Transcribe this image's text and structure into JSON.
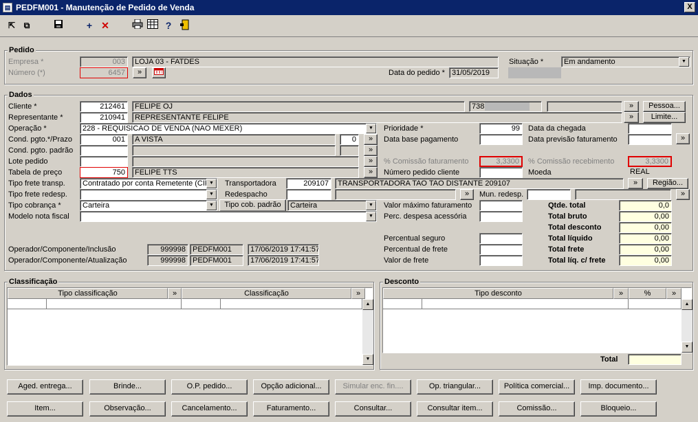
{
  "window": {
    "title": "PEDFM001 - Manutenção de Pedido de Venda",
    "close": "X"
  },
  "toolbar": {
    "icons": [
      "navigate-icon",
      "copy-icon",
      "save-icon",
      "add-icon",
      "delete-icon",
      "print-icon",
      "grid-icon",
      "help-icon",
      "exit-icon"
    ],
    "add": "+",
    "delete": "✕",
    "help": "?"
  },
  "pedido": {
    "title": "Pedido",
    "empresa_label": "Empresa *",
    "empresa_code": "003",
    "empresa_name": "LOJA 03 - FATDES",
    "numero_label": "Número (*)",
    "numero_value": "6457",
    "data_label": "Data do pedido *",
    "data_value": "31/05/2019",
    "situacao_label": "Situação *",
    "situacao_value": "Em andamento"
  },
  "dados": {
    "title": "Dados",
    "cliente_label": "Cliente *",
    "cliente_code": "212461",
    "cliente_name": "FELIPE OJ",
    "cliente_extra": "738",
    "representante_label": "Representante *",
    "representante_code": "210941",
    "representante_name": "REPRESENTANTE FELIPE",
    "operacao_label": "Operação *",
    "operacao_value": "228 - REQUISICAO DE VENDA (NAO MEXER)",
    "cond_label": "Cond. pgto.*/Prazo",
    "cond_code": "001",
    "cond_name": "A VISTA",
    "cond_prazo": "0",
    "cond_padrao_label": "Cond. pgto. padrão",
    "lote_label": "Lote pedido",
    "tabela_label": "Tabela de preço",
    "tabela_code": "750",
    "tabela_name": "FELIPE TTS",
    "frete_transp_label": "Tipo frete transp.",
    "frete_transp_value": "Contratado por conta Remetente (CIF)",
    "frete_redesp_label": "Tipo frete redesp.",
    "cobranca_label": "Tipo cobrança *",
    "cobranca_value": "Carteira",
    "modelo_label": "Modelo nota fiscal",
    "transportadora_label": "Transportadora",
    "transportadora_code": "209107",
    "transportadora_name": "TRANSPORTADORA TAO TAO DISTANTE  209107",
    "redespacho_label": "Redespacho",
    "mun_redesp_label": "Mun. redesp.",
    "tipo_cob_padrao_button": "Tipo cob. padrão",
    "tipo_cob_padrao_value": "Carteira",
    "prioridade_label": "Prioridade *",
    "prioridade_value": "99",
    "data_base_label": "Data base pagamento",
    "comissao_fat_label": "% Comissão faturamento",
    "comissao_fat_value": "3,3300",
    "numero_cliente_label": "Número pedido cliente",
    "data_chegada_label": "Data da chegada",
    "data_previsao_label": "Data previsão faturamento",
    "comissao_rec_label": "% Comissão recebimento",
    "comissao_rec_value": "3,3300",
    "moeda_label": "Moeda",
    "moeda_value": "REAL",
    "valor_max_label": "Valor máximo faturamento",
    "perc_despesa_label": "Perc. despesa acessória",
    "perc_seguro_label": "Percentual seguro",
    "perc_frete_label": "Percentual de frete",
    "valor_frete_label": "Valor de frete",
    "pessoa_button": "Pessoa...",
    "limite_button": "Limite...",
    "regiao_button": "Região...",
    "more": "»",
    "totals": [
      {
        "label": "Qtde. total",
        "value": "0,0"
      },
      {
        "label": "Total bruto",
        "value": "0,00"
      },
      {
        "label": "Total desconto",
        "value": "0,00"
      },
      {
        "label": "Total líquido",
        "value": "0,00"
      },
      {
        "label": "Total frete",
        "value": "0,00"
      },
      {
        "label": "Total líq. c/ frete",
        "value": "0,00"
      }
    ],
    "op_inclusao_label": "Operador/Componente/Inclusão",
    "op_inclusao_user": "999998",
    "op_inclusao_comp": "PEDFM001",
    "op_inclusao_date": "17/06/2019 17:41:57",
    "op_atualizacao_label": "Operador/Componente/Atualização",
    "op_atualizacao_user": "999998",
    "op_atualizacao_comp": "PEDFM001",
    "op_atualizacao_date": "17/06/2019 17:41:57"
  },
  "classificacao": {
    "title": "Classificação",
    "col1": "Tipo classificação",
    "col2": "Classificação"
  },
  "desconto": {
    "title": "Desconto",
    "col1": "Tipo desconto",
    "col2": "%",
    "total_label": "Total"
  },
  "buttons": {
    "row1": [
      "Aged. entrega...",
      "Brinde...",
      "O.P. pedido...",
      "Opção adicional...",
      "Simular enc. fin....",
      "Op. triangular...",
      "Política comercial...",
      "Imp. documento..."
    ],
    "row2": [
      "Item...",
      "Observação...",
      "Cancelamento...",
      "Faturamento...",
      "Consultar...",
      "Consultar item...",
      "Comissão...",
      "Bloqueio..."
    ]
  }
}
